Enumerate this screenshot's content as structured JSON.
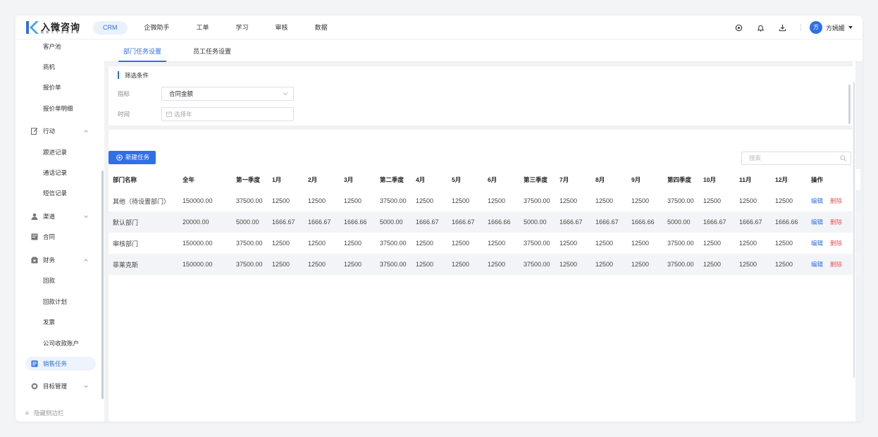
{
  "logo": {
    "name": "入微咨询",
    "slogan": "赋 智 入 才 灵 动 未 来"
  },
  "topnav": [
    {
      "label": "CRM",
      "active": true
    },
    {
      "label": "企微助手"
    },
    {
      "label": "工单"
    },
    {
      "label": "学习"
    },
    {
      "label": "审核"
    },
    {
      "label": "数据"
    }
  ],
  "user": {
    "avatar_text": "方",
    "name": "方嫣媛"
  },
  "sidebar": {
    "items": [
      {
        "label": "客户池"
      },
      {
        "label": "商机"
      },
      {
        "label": "报价单"
      },
      {
        "label": "报价单明细"
      },
      {
        "label": "行动",
        "icon": "edit-icon"
      },
      {
        "label": "跟进记录"
      },
      {
        "label": "通话记录"
      },
      {
        "label": "短信记录"
      },
      {
        "label": "渠道",
        "icon": "user-icon"
      },
      {
        "label": "合同",
        "icon": "contract-icon"
      },
      {
        "label": "财务",
        "icon": "finance-icon"
      },
      {
        "label": "回款"
      },
      {
        "label": "回款计划"
      },
      {
        "label": "发票"
      },
      {
        "label": "公司收款账户"
      },
      {
        "label": "销售任务",
        "icon": "task-icon",
        "active": true
      },
      {
        "label": "目标管理",
        "icon": "target-icon"
      }
    ],
    "hide_label": "隐藏侧边栏"
  },
  "tabs": [
    {
      "label": "部门任务设置",
      "active": true
    },
    {
      "label": "员工任务设置"
    }
  ],
  "filter": {
    "title": "筛选条件",
    "metric_label": "指标",
    "metric_value": "合同金额",
    "time_label": "时间",
    "time_placeholder": "选择年"
  },
  "actions": {
    "new_task": "新建任务",
    "search_placeholder": "搜索"
  },
  "colors": {
    "accent": "#2f6fe8",
    "danger": "#e65a5a",
    "active_bg": "#eaf1fd"
  },
  "table": {
    "headers": [
      "部门名称",
      "全年",
      "第一季度",
      "1月",
      "2月",
      "3月",
      "第二季度",
      "4月",
      "5月",
      "6月",
      "第三季度",
      "7月",
      "8月",
      "9月",
      "第四季度",
      "10月",
      "11月",
      "12月",
      "操作"
    ],
    "rows": [
      [
        "其他（待设置部门）",
        "150000.00",
        "37500.00",
        "12500",
        "12500",
        "12500",
        "37500.00",
        "12500",
        "12500",
        "12500",
        "37500.00",
        "12500",
        "12500",
        "12500",
        "37500.00",
        "12500",
        "12500",
        "12500"
      ],
      [
        "默认部门",
        "20000.00",
        "5000.00",
        "1666.67",
        "1666.67",
        "1666.66",
        "5000.00",
        "1666.67",
        "1666.67",
        "1666.66",
        "5000.00",
        "1666.67",
        "1666.67",
        "1666.66",
        "5000.00",
        "1666.67",
        "1666.67",
        "1666.66"
      ],
      [
        "审核部门",
        "150000.00",
        "37500.00",
        "12500",
        "12500",
        "12500",
        "37500.00",
        "12500",
        "12500",
        "12500",
        "37500.00",
        "12500",
        "12500",
        "12500",
        "37500.00",
        "12500",
        "12500",
        "12500"
      ],
      [
        "菲莱克斯",
        "150000.00",
        "37500.00",
        "12500",
        "12500",
        "12500",
        "37500.00",
        "12500",
        "12500",
        "12500",
        "37500.00",
        "12500",
        "12500",
        "12500",
        "37500.00",
        "12500",
        "12500",
        "12500"
      ]
    ],
    "edit_label": "编辑",
    "delete_label": "删除"
  }
}
